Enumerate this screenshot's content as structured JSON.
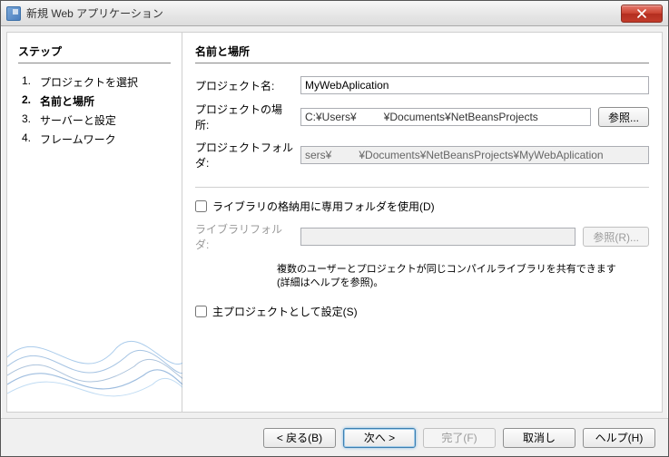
{
  "window": {
    "title": "新規 Web アプリケーション"
  },
  "sidebar": {
    "heading": "ステップ",
    "items": [
      {
        "num": "1.",
        "label": "プロジェクトを選択"
      },
      {
        "num": "2.",
        "label": "名前と場所"
      },
      {
        "num": "3.",
        "label": "サーバーと設定"
      },
      {
        "num": "4.",
        "label": "フレームワーク"
      }
    ],
    "current_index": 1
  },
  "main": {
    "heading": "名前と場所",
    "project_name": {
      "label": "プロジェクト名:",
      "value": "MyWebAplication"
    },
    "project_location": {
      "label": "プロジェクトの場所:",
      "value": "C:¥Users¥         ¥Documents¥NetBeansProjects",
      "browse": "参照..."
    },
    "project_folder": {
      "label": "プロジェクトフォルダ:",
      "value": "sers¥         ¥Documents¥NetBeansProjects¥MyWebAplication"
    },
    "libs_checkbox": {
      "label": "ライブラリの格納用に専用フォルダを使用(D)"
    },
    "libs_folder": {
      "label": "ライブラリフォルダ:",
      "value": "",
      "browse": "参照(R)..."
    },
    "note_line1": "複数のユーザーとプロジェクトが同じコンパイルライブラリを共有できます",
    "note_line2": "(詳細はヘルプを参照)。",
    "main_project_checkbox": {
      "label": "主プロジェクトとして設定(S)"
    }
  },
  "buttons": {
    "back": "< 戻る(B)",
    "next": "次へ >",
    "finish": "完了(F)",
    "cancel": "取消し",
    "help": "ヘルプ(H)"
  }
}
